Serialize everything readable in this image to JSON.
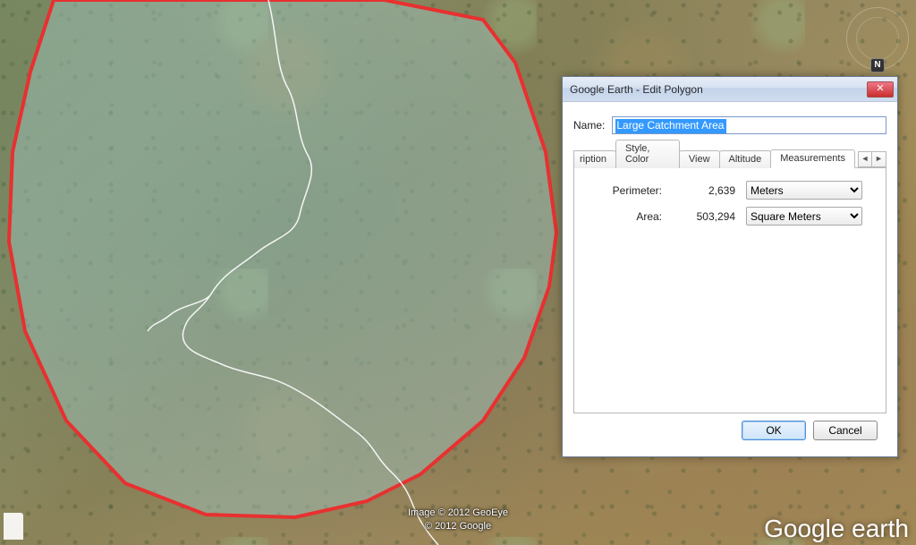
{
  "compass": {
    "n": "N"
  },
  "attribution": "Image © 2012 GeoEye\n© 2012 Google",
  "logo": {
    "brand": "Google",
    "product": " earth"
  },
  "dialog": {
    "title": "Google Earth - Edit Polygon",
    "close_glyph": "✕",
    "name_label": "Name:",
    "name_value": "Large Catchment Area",
    "tabs": {
      "description_trunc": "ription",
      "style_color": "Style, Color",
      "view": "View",
      "altitude": "Altitude",
      "measurements": "Measurements",
      "scroll_left": "◄",
      "scroll_right": "►"
    },
    "measurements": {
      "perimeter_label": "Perimeter:",
      "perimeter_value": "2,639",
      "perimeter_unit": "Meters",
      "area_label": "Area:",
      "area_value": "503,294",
      "area_unit": "Square Meters"
    },
    "buttons": {
      "ok": "OK",
      "cancel": "Cancel"
    }
  }
}
